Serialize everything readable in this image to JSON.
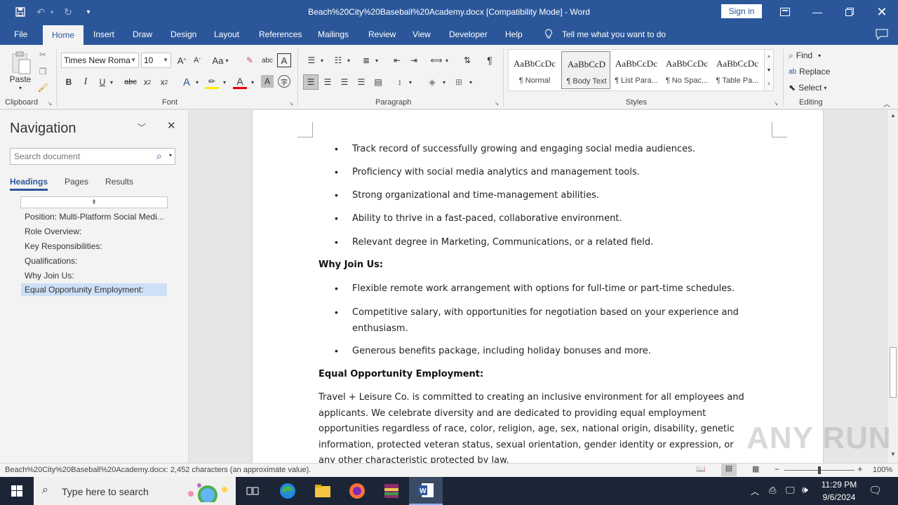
{
  "window": {
    "title": "Beach%20City%20Baseball%20Academy.docx [Compatibility Mode]  -  Word",
    "sign_in": "Sign in"
  },
  "ribbon_tabs": [
    "File",
    "Home",
    "Insert",
    "Draw",
    "Design",
    "Layout",
    "References",
    "Mailings",
    "Review",
    "View",
    "Developer",
    "Help"
  ],
  "active_tab": "Home",
  "tell_me": "Tell me what you want to do",
  "clipboard": {
    "paste": "Paste",
    "label": "Clipboard"
  },
  "font": {
    "name": "Times New Roma",
    "size": "10",
    "label": "Font",
    "case_btn": "Aa"
  },
  "paragraph": {
    "label": "Paragraph"
  },
  "styles": {
    "label": "Styles",
    "items": [
      {
        "preview": "AaBbCcDc",
        "name": "¶ Normal"
      },
      {
        "preview": "AaBbCcD",
        "name": "¶ Body Text"
      },
      {
        "preview": "AaBbCcDc",
        "name": "¶ List Para..."
      },
      {
        "preview": "AaBbCcDc",
        "name": "¶ No Spac..."
      },
      {
        "preview": "AaBbCcDc",
        "name": "¶ Table Pa..."
      }
    ]
  },
  "editing": {
    "find": "Find",
    "replace": "Replace",
    "select": "Select",
    "label": "Editing"
  },
  "navigation": {
    "title": "Navigation",
    "search_placeholder": "Search document",
    "tabs": [
      "Headings",
      "Pages",
      "Results"
    ],
    "headings": [
      "Position: Multi-Platform Social Medi...",
      "Role Overview:",
      "Key Responsibilities:",
      "Qualifications:",
      "Why Join Us:",
      "Equal Opportunity Employment:"
    ],
    "selected_heading": "Equal Opportunity Employment:"
  },
  "document": {
    "qualifications_bullets": [
      "Track record of successfully growing and engaging social media audiences.",
      "Proficiency with social media analytics and management tools.",
      "Strong organizational and time-management abilities.",
      "Ability to thrive in a fast-paced, collaborative environment.",
      "Relevant degree in Marketing, Communications, or a related field."
    ],
    "why_join_heading": "Why Join Us:",
    "why_join_bullets": [
      "Flexible remote work arrangement with options for full-time or part-time schedules.",
      "Competitive salary, with opportunities for negotiation based on your experience and enthusiasm.",
      "Generous benefits package, including holiday bonuses  and more."
    ],
    "eeo_heading": "Equal Opportunity Employment:",
    "eeo_paragraph": "Travel + Leisure Co. is committed to creating an inclusive environment for all employees and applicants. We celebrate diversity and are dedicated to providing equal employment opportunities  regardless of race, color, religion, age, sex, national origin, disability, genetic information, protected veteran status, sexual orientation, gender identity or expression, or any other characteristic protected by law."
  },
  "status": {
    "text": "Beach%20City%20Baseball%20Academy.docx: 2,452 characters (an approximate value).",
    "zoom": "100%"
  },
  "taskbar": {
    "search_placeholder": "Type here to search",
    "time": "11:29 PM",
    "date": "9/6/2024"
  },
  "watermark": "ANY RUN",
  "colors": {
    "accent": "#2b579a",
    "taskbar": "#1c2535"
  }
}
